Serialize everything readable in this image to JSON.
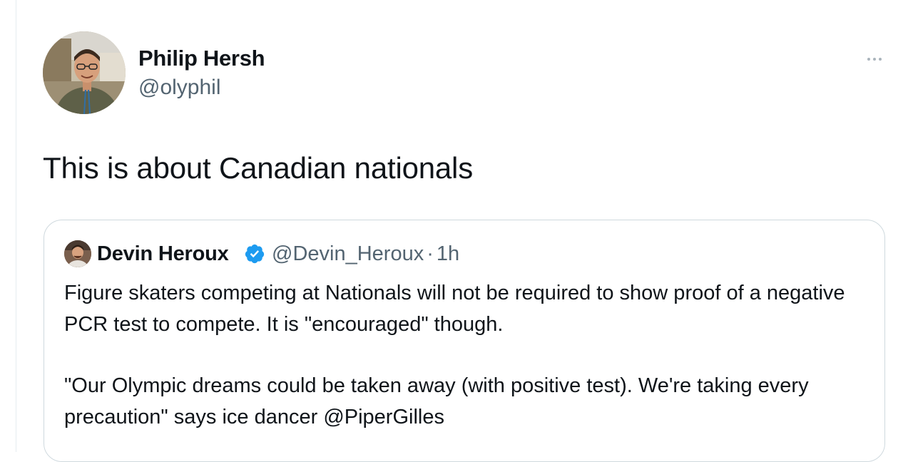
{
  "tweet": {
    "author_name": "Philip Hersh",
    "author_handle": "@olyphil",
    "text": "This is about Canadian nationals",
    "more_icon": "more-horizontal-icon"
  },
  "quoted_tweet": {
    "author_name": "Devin Heroux",
    "verified_icon": "verified-badge-icon",
    "author_handle": "@Devin_Heroux",
    "separator": "·",
    "time": "1h",
    "paragraphs": [
      "Figure skaters competing at Nationals will not be required to show proof of a negative PCR test to compete. It is \"encouraged\" though.",
      "\"Our Olympic dreams could be taken away (with positive test). We're taking every precaution\" says ice dancer @PiperGilles"
    ]
  },
  "colors": {
    "text_primary": "#0f1419",
    "text_secondary": "#536471",
    "border": "#cfd9de",
    "verified_blue": "#1d9bf0"
  }
}
